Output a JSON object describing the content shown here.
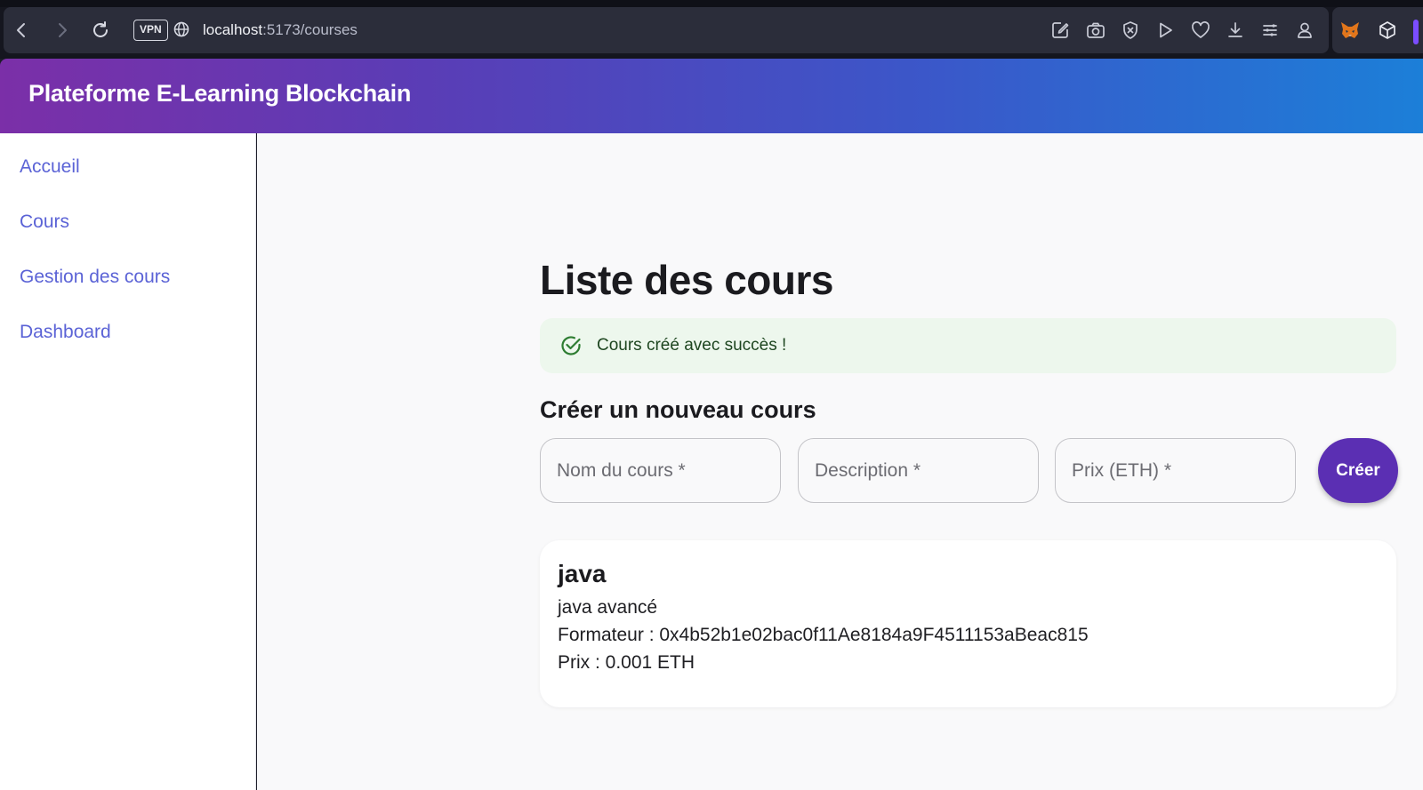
{
  "browser": {
    "vpn_label": "VPN",
    "url_host": "localhost",
    "url_path": ":5173/courses"
  },
  "header": {
    "title": "Plateforme E-Learning Blockchain"
  },
  "sidebar": {
    "items": [
      {
        "label": "Accueil"
      },
      {
        "label": "Cours"
      },
      {
        "label": "Gestion des cours"
      },
      {
        "label": "Dashboard"
      }
    ]
  },
  "main": {
    "title": "Liste des cours",
    "alert": {
      "text": "Cours créé avec succès !",
      "color": "#edf7ed"
    },
    "form": {
      "title": "Créer un nouveau cours",
      "name_placeholder": "Nom du cours *",
      "description_placeholder": "Description *",
      "price_placeholder": "Prix (ETH) *",
      "submit_label": "Créer",
      "accent": "#5b2fb3"
    },
    "courses": [
      {
        "name": "java",
        "description": "java avancé",
        "trainer": "Formateur : 0x4b52b1e02bac0f11Ae8184a9F4511153aBeac815",
        "price": "Prix : 0.001 ETH"
      }
    ]
  }
}
